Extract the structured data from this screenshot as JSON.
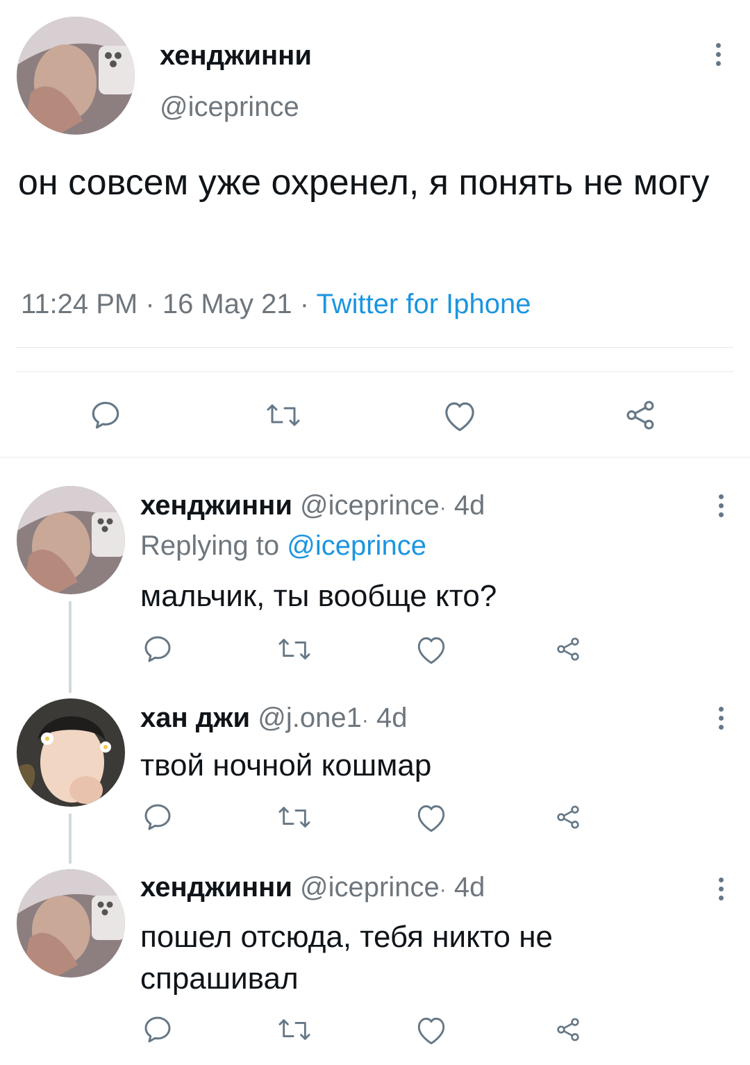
{
  "main_tweet": {
    "display_name": "хенджинни",
    "handle": "@iceprince",
    "text": "он совсем уже охренел, я понять не могу",
    "time": "11:24 PM",
    "date": "16 May 21",
    "separator": "·",
    "source": "Twitter for Iphone",
    "actions": [
      "reply-icon",
      "retweet-icon",
      "like-icon",
      "share-icon"
    ]
  },
  "replies": [
    {
      "display_name": "хенджинни",
      "handle": "@iceprince",
      "age": "4d",
      "separator": "·",
      "replying_prefix": "Replying to",
      "replying_to": "@iceprince",
      "text": "мальчик, ты вообще кто?"
    },
    {
      "display_name": "хан джи",
      "handle": "@j.one1",
      "age": "4d",
      "separator": "·",
      "text": "твой ночной кошмар"
    },
    {
      "display_name": "хенджинни",
      "handle": "@iceprince",
      "age": "4d",
      "separator": "·",
      "text": "пошел отсюда, тебя никто не спрашивал"
    }
  ],
  "colors": {
    "text": "#0f1419",
    "secondary": "#6e767d",
    "link": "#1b95e0",
    "divider": "#e1e8ed",
    "thread_line": "#cfd9de"
  }
}
